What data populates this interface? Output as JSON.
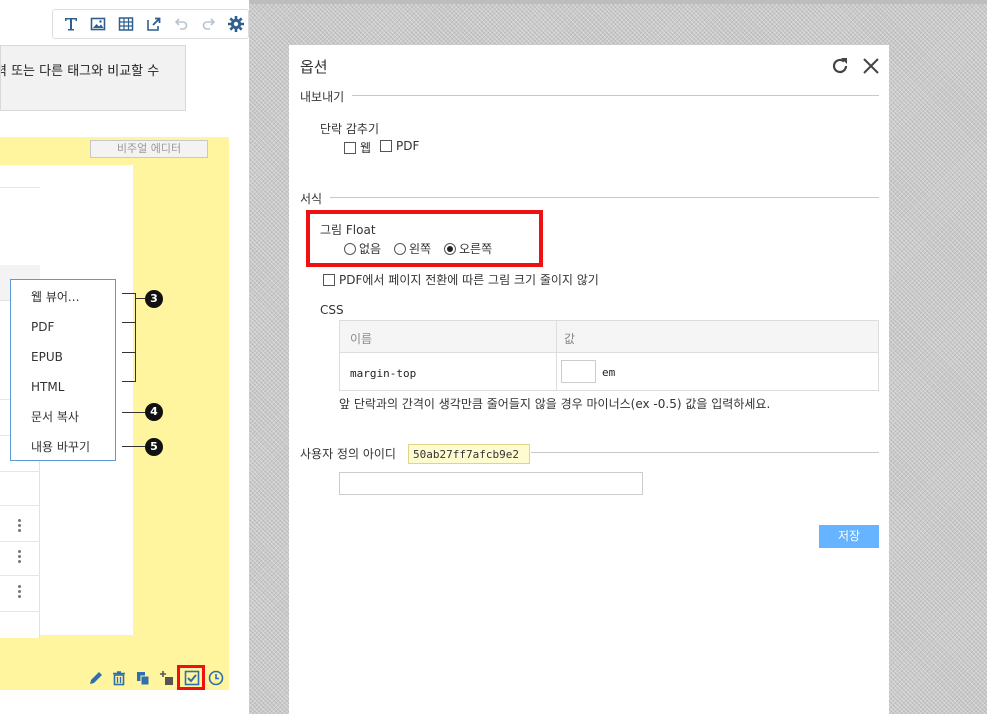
{
  "editor": {
    "text_snippet": "력 또는 다른 태그와 비교할 수",
    "visual_editor_label": "비주얼 에디터",
    "toolbar_icons": [
      "text-icon",
      "image-icon",
      "table-icon",
      "export-icon",
      "undo-icon",
      "redo-icon",
      "gear-icon"
    ],
    "bottom_icons": [
      "pencil-icon",
      "trash-icon",
      "copy-icon",
      "add-icon",
      "check-icon",
      "clock-icon"
    ]
  },
  "context_menu": {
    "items": [
      "웹 뷰어...",
      "PDF",
      "EPUB",
      "HTML",
      "문서 복사",
      "내용 바꾸기"
    ],
    "markers": [
      "3",
      "4",
      "5"
    ]
  },
  "dialog": {
    "title": "옵션",
    "export_section": "내보내기",
    "paragraph_hide_label": "단락 감추기",
    "hide_web": "웹",
    "hide_pdf": "PDF",
    "format_section": "서식",
    "float_label": "그림 Float",
    "float_options": [
      "없음",
      "왼쪽",
      "오른쪽"
    ],
    "float_selected": "오른쪽",
    "pdf_no_shrink_label": "PDF에서 페이지 전환에 따른 그림 크기 줄이지 않기",
    "css_label": "CSS",
    "css_col_name": "이름",
    "css_col_value": "값",
    "css_property": "margin-top",
    "css_unit": "em",
    "css_hint": "앞 단락과의 간격이 생각만큼 줄어들지 않을 경우 마이너스(ex -0.5) 값을 입력하세요.",
    "user_id_label": "사용자 정의 아이디",
    "user_id_value": "50ab27ff7afcb9e2",
    "save_label": "저장"
  },
  "colors": {
    "highlight_red": "#ee1111",
    "save_button": "#66b3ff",
    "panel_yellow": "#fff59e",
    "menu_border": "#5b9bd5"
  }
}
